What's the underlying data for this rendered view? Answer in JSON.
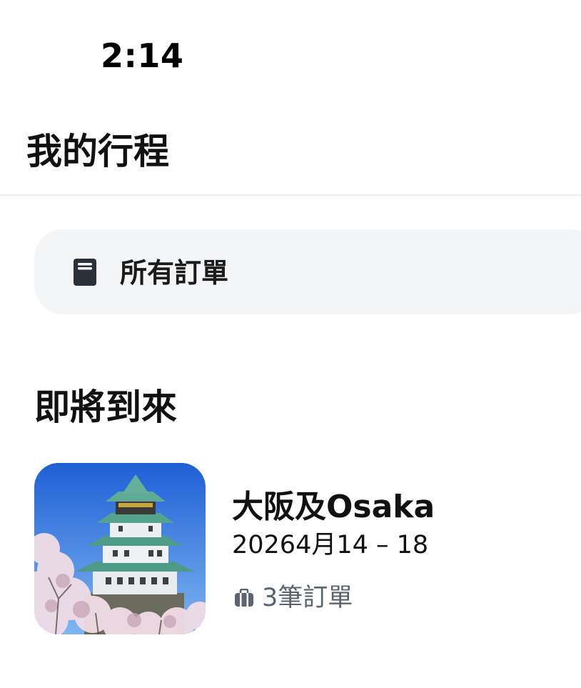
{
  "status_bar": {
    "time": "2:14"
  },
  "header": {
    "title": "我的行程"
  },
  "orders_card": {
    "label": "所有訂單",
    "icon": "book-icon"
  },
  "upcoming": {
    "title": "即將到來",
    "trips": [
      {
        "name": "大阪及Osaka",
        "dates": "20264月14 – 18",
        "orders_label": "3筆訂單",
        "image": "osaka-castle-photo",
        "orders_icon": "briefcase-icon"
      }
    ]
  },
  "colors": {
    "card_bg": "#f4f5f7",
    "icon_dark": "#2b2f38",
    "secondary_text": "#5b6371"
  }
}
